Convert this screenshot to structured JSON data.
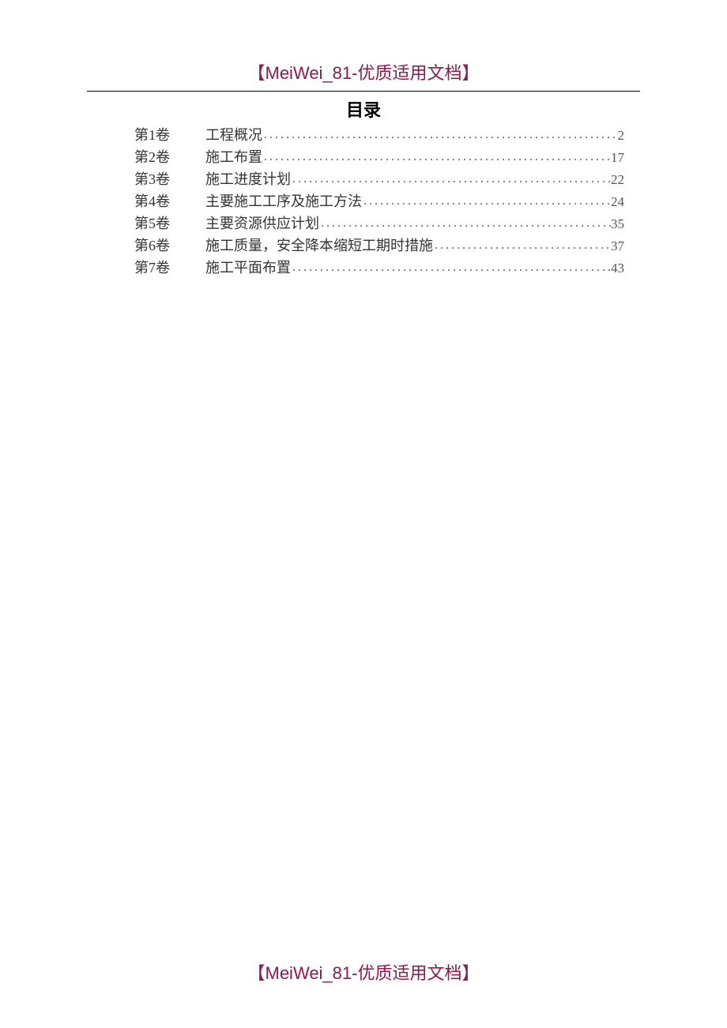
{
  "header": "【MeiWei_81-优质适用文档】",
  "title": "目录",
  "toc": [
    {
      "vol": "第1卷",
      "label": "工程概况",
      "page": "2"
    },
    {
      "vol": "第2卷",
      "label": "施工布置",
      "page": "17"
    },
    {
      "vol": "第3卷",
      "label": "施工进度计划",
      "page": "22"
    },
    {
      "vol": "第4卷",
      "label": "主要施工工序及施工方法",
      "page": "24"
    },
    {
      "vol": "第5卷",
      "label": "主要资源供应计划",
      "page": "35"
    },
    {
      "vol": "第6卷",
      "label": "施工质量，安全降本缩短工期时措施",
      "page": "37"
    },
    {
      "vol": "第7卷",
      "label": "施工平面布置",
      "page": "43"
    }
  ],
  "footer": "【MeiWei_81-优质适用文档】"
}
